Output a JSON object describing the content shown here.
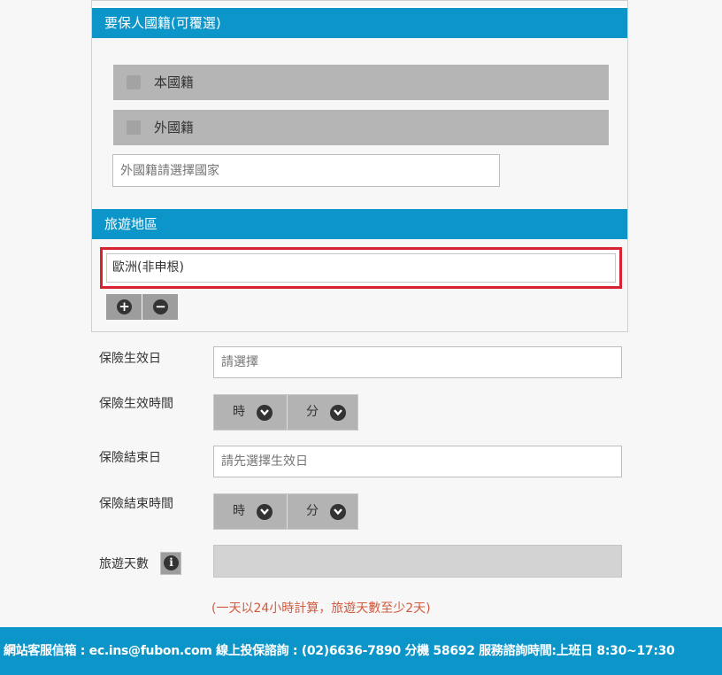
{
  "nationality": {
    "header": "要保人國籍(可覆選)",
    "options": [
      {
        "label": "本國籍",
        "checked": false
      },
      {
        "label": "外國籍",
        "checked": false
      }
    ],
    "country_placeholder": "外國籍請選擇國家"
  },
  "region": {
    "header": "旅遊地區",
    "selected": "歐洲(非申根)",
    "add_icon": "plus-circle-icon",
    "remove_icon": "minus-circle-icon"
  },
  "form": {
    "start_date_label": "保險生效日",
    "start_date_placeholder": "請選擇",
    "start_time_label": "保險生效時間",
    "end_date_label": "保險結束日",
    "end_date_placeholder": "請先選擇生效日",
    "end_time_label": "保險結束時間",
    "hour_label": "時",
    "minute_label": "分",
    "days_label": "旅遊天數",
    "days_value": "",
    "note": "(一天以24小時計算，旅遊天數至少2天)"
  },
  "footer": {
    "text": "網站客服信箱 : ec.ins@fubon.com 線上投保諮詢 : (02)6636-7890 分機 58692 服務諮詢時間:上班日 8:30~17:30"
  },
  "colors": {
    "header_blue": "#0b95c9",
    "highlight_red": "#d6232f",
    "note_orange": "#d15b3e"
  }
}
